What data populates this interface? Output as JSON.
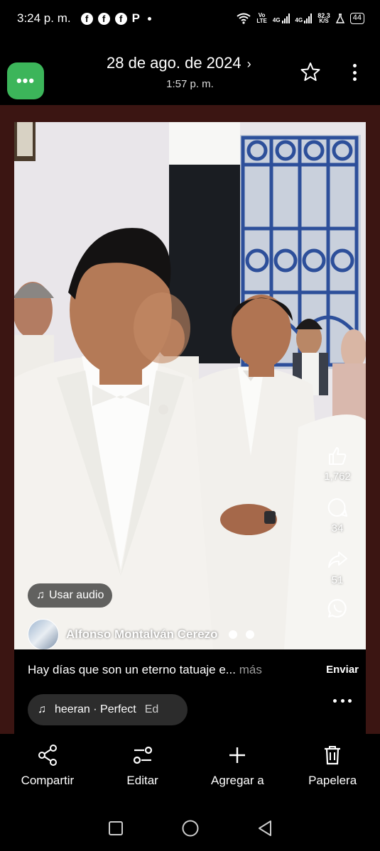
{
  "status_bar": {
    "time": "3:24 p. m.",
    "net_vo": "Vo",
    "net_lte": "LTE",
    "net_4g_1": "4G",
    "net_4g_2": "4G",
    "speed_value": "82.3",
    "speed_unit": "K/S",
    "battery": "44"
  },
  "header": {
    "date": "28 de ago. de 2024",
    "time": "1:57 p. m.",
    "app_button_icon": "more-dots-icon",
    "app_button_color": "#3cb55a"
  },
  "post": {
    "like_count": "1,762",
    "comment_count": "34",
    "share_count": "51",
    "audio_label": "Usar audio",
    "author": "Alfonso Montalván Cerezo",
    "caption": "Hay días que son un eterno tatuaje e...",
    "caption_more": "más",
    "send_label": "Enviar",
    "music": "heeran · Perfect",
    "music_extra": "Ed"
  },
  "actions": [
    {
      "label": "Compartir",
      "icon": "share-icon"
    },
    {
      "label": "Editar",
      "icon": "edit-sliders-icon"
    },
    {
      "label": "Agregar a",
      "icon": "plus-icon"
    },
    {
      "label": "Papelera",
      "icon": "trash-icon"
    }
  ],
  "colors": {
    "frame_border": "#3b1512",
    "suit_white": "#f2f0ec",
    "gate_blue": "#2d4f9a"
  }
}
